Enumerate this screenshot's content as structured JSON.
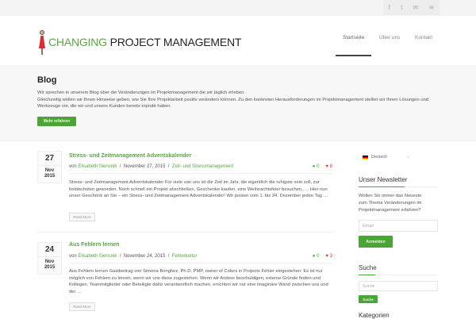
{
  "social": {
    "icons": [
      "facebook-icon",
      "twitter-icon",
      "email-icon",
      "rss-icon"
    ],
    "glyphs": [
      "f",
      "t",
      "✉",
      "≋"
    ]
  },
  "logo": {
    "green": "CHANGING",
    "dark": "PROJECT MANAGEMENT"
  },
  "nav": [
    "Startseite",
    "Über uns",
    "Kontakt"
  ],
  "intro": {
    "title": "Blog",
    "lines": [
      "Wir sprechen in unserem Blog über die Veränderungen im Projektmanagement die wir täglich erleben.",
      "Gleichzeitig wollen wir Ihnen Hinweise geben, wie Sie Ihre Projektarbeit positiv verändern können. Zu den konkreten Herausforderungen im Projektmanagement stellen wir Ihnen Lösungen und Werkzeuge vor, die wir und unsere Kunden bereits erprobt haben."
    ],
    "button": "Mehr erfahren"
  },
  "posts": [
    {
      "day": "27",
      "month": "Nov",
      "year": "2015",
      "title": "Stress- und Zeitmanagement Adventskalender",
      "by": "von",
      "author": "Elisabeth Siencnik",
      "date": "November 27, 2015",
      "category": "Zeit- und Stressmanagement",
      "comments": "0",
      "likes": "8",
      "excerpt": "Stress- und Zeitmanagement Adventskalender   Für viele von uns ist die Zeit im Jahr, die eigentlich die ruhigste sein soll, zur hektischsten geworden. Noch schnell ein Projekt abschließen, Geschenke kaufen, eine Weihnachtsfeier besuchen,….   Hier nun unser Geschenk an Sie – ein Stress- und Zeitmanagement Adventskalender!   Wir posten vom  1. bis 24. Dezember jeden Tag …",
      "readmore": "Read More"
    },
    {
      "day": "24",
      "month": "Nov",
      "year": "2015",
      "title": "Aus Fehlern lernen",
      "by": "von",
      "author": "Elisabeth Siencnik",
      "date": "November 24, 2015",
      "category": "Fehlerkultur",
      "comments": "0",
      "likes": "3",
      "excerpt": "Aus Fehlern lernen Gastbeitrag von Simona Bonghez, Ph.D, PMP, owner of Colors in Projects   Fehler eingestehen: Es ist nur möglich von Fehlern zu lernen, wenn wir uns diese zugestehen. Wenn wir Andere beschuldigen, externe Gründe finden und Kollegen, Teammitglieder oder Beteiligte dafür verantwortlich machen, errichten wir nur eine imaginäre Wand zwischen uns und der …",
      "readmore": "Read More"
    }
  ],
  "sidebar": {
    "language": "Deutsch",
    "newsletter_title": "Unser Newsletter",
    "newsletter_text": "Wollen Sie immer das Neueste zum Thema Veränderungen im Projektmanagement erfahren?",
    "email_placeholder": "Email",
    "subscribe": "Anmelden",
    "search_title": "Suche",
    "search_placeholder": "Suche",
    "search_button": "Suche",
    "categories_title": "Kategorien"
  },
  "colors": {
    "accent": "#4aa536",
    "heart": "#d9323e"
  }
}
